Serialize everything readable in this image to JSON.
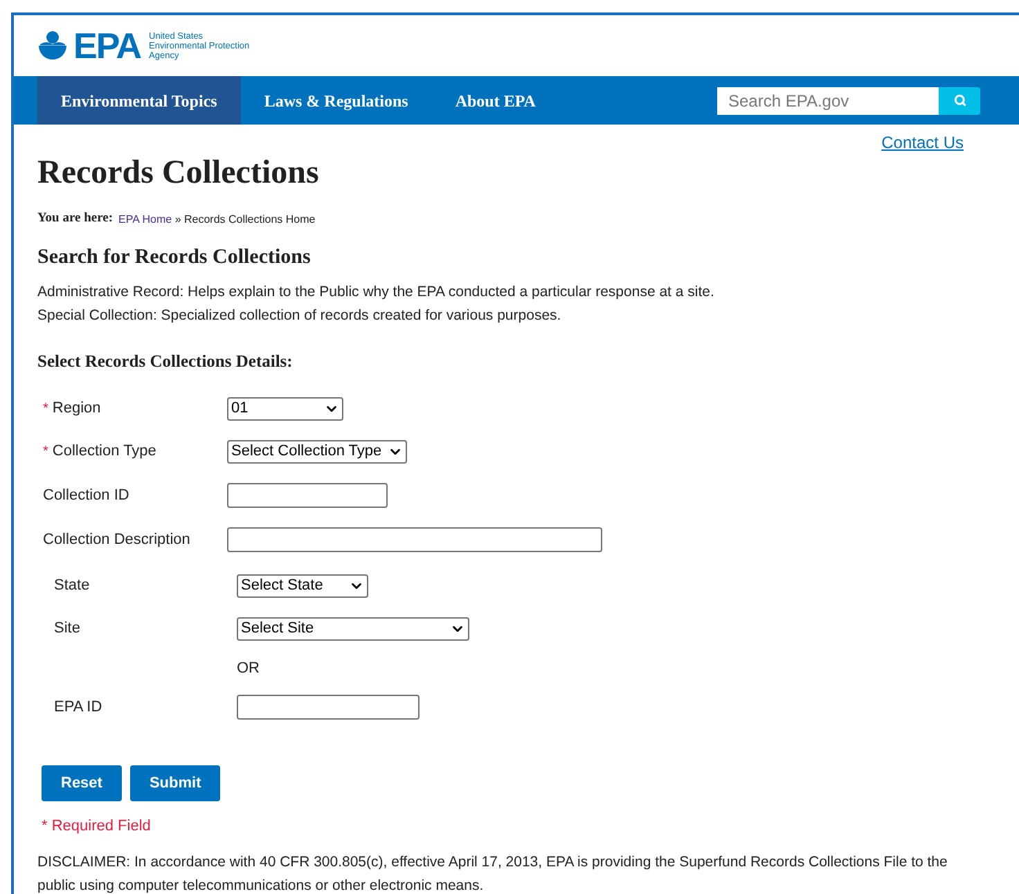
{
  "logo": {
    "mark": "EPA",
    "agency_lines": [
      "United States",
      "Environmental Protection",
      "Agency"
    ]
  },
  "nav": [
    {
      "label": "Environmental Topics",
      "selected": true
    },
    {
      "label": "Laws & Regulations",
      "selected": false
    },
    {
      "label": "About EPA",
      "selected": false
    }
  ],
  "search": {
    "placeholder": "Search EPA.gov"
  },
  "contact_link": "Contact Us",
  "title": "Records Collections",
  "breadcrumb": {
    "label": "You are here:",
    "link": "EPA Home",
    "separator": "»",
    "current": "Records Collections Home"
  },
  "search_heading": "Search for Records Collections",
  "descriptions": [
    "Administrative Record: Helps explain to the Public why the EPA conducted a particular response at a site.",
    "Special Collection: Specialized collection of records created for various purposes."
  ],
  "details_heading": "Select Records Collections Details:",
  "fields": [
    {
      "label": "Region",
      "required": true,
      "kind": "select",
      "value": "01"
    },
    {
      "label": "Collection Type",
      "required": true,
      "kind": "select",
      "value": "Select Collection Type"
    },
    {
      "label": "Collection ID",
      "required": false,
      "kind": "text"
    },
    {
      "label": "Collection Description",
      "required": false,
      "kind": "text"
    }
  ],
  "site_lookup": {
    "fields": [
      {
        "label": "State",
        "kind": "select",
        "value": "Select State"
      },
      {
        "label": "Site",
        "kind": "select",
        "value": "Select Site"
      }
    ],
    "separator": "OR",
    "id_field": {
      "label": "EPA ID",
      "kind": "text"
    }
  },
  "buttons": [
    "Reset",
    "Submit"
  ],
  "required_note": {
    "mark": "*",
    "text": "Required Field"
  },
  "disclaimer": "DISCLAIMER: In accordance with 40 CFR 300.805(c), effective April 17, 2013, EPA is providing the Superfund Records Collections File to the public using computer telecommunications or other electronic means."
}
